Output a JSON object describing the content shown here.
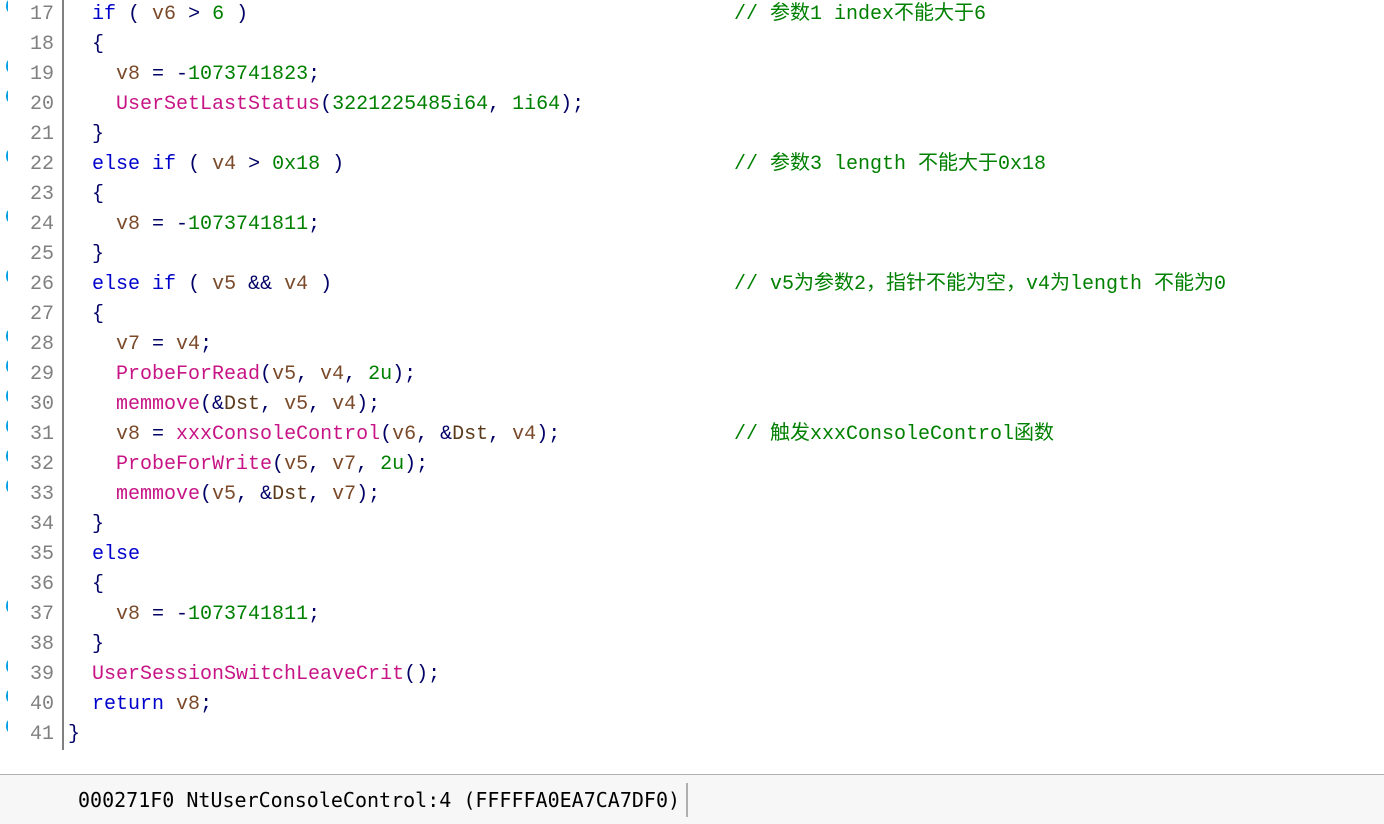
{
  "lines": [
    {
      "num": 17,
      "bp": true,
      "tokens": [
        [
          "  ",
          "p"
        ],
        [
          "if",
          "kw"
        ],
        [
          " ( ",
          "p"
        ],
        [
          "v6",
          "var"
        ],
        [
          " > ",
          "op"
        ],
        [
          "6",
          "num"
        ],
        [
          " )",
          "p"
        ]
      ],
      "comment": "// 参数1 index不能大于6",
      "commentCol": 740
    },
    {
      "num": 18,
      "bp": false,
      "tokens": [
        [
          "  {",
          "p"
        ]
      ]
    },
    {
      "num": 19,
      "bp": true,
      "tokens": [
        [
          "    ",
          "p"
        ],
        [
          "v8",
          "var"
        ],
        [
          " = -",
          "op"
        ],
        [
          "1073741823",
          "num"
        ],
        [
          ";",
          "p"
        ]
      ]
    },
    {
      "num": 20,
      "bp": true,
      "tokens": [
        [
          "    ",
          "p"
        ],
        [
          "UserSetLastStatus",
          "call"
        ],
        [
          "(",
          "p"
        ],
        [
          "3221225485i64",
          "num"
        ],
        [
          ", ",
          "p"
        ],
        [
          "1i64",
          "num"
        ],
        [
          ");",
          "p"
        ]
      ]
    },
    {
      "num": 21,
      "bp": false,
      "tokens": [
        [
          "  }",
          "p"
        ]
      ]
    },
    {
      "num": 22,
      "bp": true,
      "tokens": [
        [
          "  ",
          "p"
        ],
        [
          "else",
          "kw"
        ],
        [
          " ",
          "p"
        ],
        [
          "if",
          "kw"
        ],
        [
          " ( ",
          "p"
        ],
        [
          "v4",
          "var"
        ],
        [
          " > ",
          "op"
        ],
        [
          "0x18",
          "num"
        ],
        [
          " )",
          "p"
        ]
      ],
      "comment": "// 参数3 length 不能大于0x18",
      "commentCol": 740
    },
    {
      "num": 23,
      "bp": false,
      "tokens": [
        [
          "  {",
          "p"
        ]
      ]
    },
    {
      "num": 24,
      "bp": true,
      "tokens": [
        [
          "    ",
          "p"
        ],
        [
          "v8",
          "var"
        ],
        [
          " = -",
          "op"
        ],
        [
          "1073741811",
          "num"
        ],
        [
          ";",
          "p"
        ]
      ]
    },
    {
      "num": 25,
      "bp": false,
      "tokens": [
        [
          "  }",
          "p"
        ]
      ]
    },
    {
      "num": 26,
      "bp": true,
      "tokens": [
        [
          "  ",
          "p"
        ],
        [
          "else",
          "kw"
        ],
        [
          " ",
          "p"
        ],
        [
          "if",
          "kw"
        ],
        [
          " ( ",
          "p"
        ],
        [
          "v5",
          "var"
        ],
        [
          " ",
          "p"
        ],
        [
          "&&",
          "op"
        ],
        [
          " ",
          "p"
        ],
        [
          "v4",
          "var"
        ],
        [
          " )",
          "p"
        ]
      ],
      "comment": "// v5为参数2，指针不能为空，v4为length 不能为0",
      "commentCol": 740
    },
    {
      "num": 27,
      "bp": false,
      "tokens": [
        [
          "  {",
          "p"
        ]
      ]
    },
    {
      "num": 28,
      "bp": true,
      "tokens": [
        [
          "    ",
          "p"
        ],
        [
          "v7",
          "var"
        ],
        [
          " = ",
          "op"
        ],
        [
          "v4",
          "var"
        ],
        [
          ";",
          "p"
        ]
      ]
    },
    {
      "num": 29,
      "bp": true,
      "tokens": [
        [
          "    ",
          "p"
        ],
        [
          "ProbeForRead",
          "call"
        ],
        [
          "(",
          "p"
        ],
        [
          "v5",
          "var"
        ],
        [
          ", ",
          "p"
        ],
        [
          "v4",
          "var"
        ],
        [
          ", ",
          "p"
        ],
        [
          "2u",
          "num"
        ],
        [
          ");",
          "p"
        ]
      ]
    },
    {
      "num": 30,
      "bp": true,
      "tokens": [
        [
          "    ",
          "p"
        ],
        [
          "memmove",
          "call"
        ],
        [
          "(&",
          "p"
        ],
        [
          "Dst",
          "sym"
        ],
        [
          ", ",
          "p"
        ],
        [
          "v5",
          "var"
        ],
        [
          ", ",
          "p"
        ],
        [
          "v4",
          "var"
        ],
        [
          ");",
          "p"
        ]
      ]
    },
    {
      "num": 31,
      "bp": true,
      "tokens": [
        [
          "    ",
          "p"
        ],
        [
          "v8",
          "var"
        ],
        [
          " = ",
          "op"
        ],
        [
          "xxxConsoleControl",
          "call"
        ],
        [
          "(",
          "p"
        ],
        [
          "v6",
          "var"
        ],
        [
          ", &",
          "p"
        ],
        [
          "Dst",
          "sym"
        ],
        [
          ", ",
          "p"
        ],
        [
          "v4",
          "var"
        ],
        [
          ");",
          "p"
        ]
      ],
      "comment": "// 触发xxxConsoleControl函数",
      "commentCol": 740
    },
    {
      "num": 32,
      "bp": true,
      "tokens": [
        [
          "    ",
          "p"
        ],
        [
          "ProbeForWrite",
          "call"
        ],
        [
          "(",
          "p"
        ],
        [
          "v5",
          "var"
        ],
        [
          ", ",
          "p"
        ],
        [
          "v7",
          "var"
        ],
        [
          ", ",
          "p"
        ],
        [
          "2u",
          "num"
        ],
        [
          ");",
          "p"
        ]
      ]
    },
    {
      "num": 33,
      "bp": true,
      "tokens": [
        [
          "    ",
          "p"
        ],
        [
          "memmove",
          "call"
        ],
        [
          "(",
          "p"
        ],
        [
          "v5",
          "var"
        ],
        [
          ", &",
          "p"
        ],
        [
          "Dst",
          "sym"
        ],
        [
          ", ",
          "p"
        ],
        [
          "v7",
          "var"
        ],
        [
          ");",
          "p"
        ]
      ]
    },
    {
      "num": 34,
      "bp": false,
      "tokens": [
        [
          "  }",
          "p"
        ]
      ]
    },
    {
      "num": 35,
      "bp": false,
      "tokens": [
        [
          "  ",
          "p"
        ],
        [
          "else",
          "kw"
        ]
      ]
    },
    {
      "num": 36,
      "bp": false,
      "tokens": [
        [
          "  {",
          "p"
        ]
      ]
    },
    {
      "num": 37,
      "bp": true,
      "tokens": [
        [
          "    ",
          "p"
        ],
        [
          "v8",
          "var"
        ],
        [
          " = -",
          "op"
        ],
        [
          "1073741811",
          "num"
        ],
        [
          ";",
          "p"
        ]
      ]
    },
    {
      "num": 38,
      "bp": false,
      "tokens": [
        [
          "  }",
          "p"
        ]
      ]
    },
    {
      "num": 39,
      "bp": true,
      "tokens": [
        [
          "  ",
          "p"
        ],
        [
          "UserSessionSwitchLeaveCrit",
          "call"
        ],
        [
          "();",
          "p"
        ]
      ]
    },
    {
      "num": 40,
      "bp": true,
      "tokens": [
        [
          "  ",
          "p"
        ],
        [
          "return",
          "kw"
        ],
        [
          " ",
          "p"
        ],
        [
          "v8",
          "var"
        ],
        [
          ";",
          "p"
        ]
      ]
    },
    {
      "num": 41,
      "bp": true,
      "tokens": [
        [
          "}",
          "p"
        ]
      ]
    }
  ],
  "status": {
    "text": "000271F0 NtUserConsoleControl:4 (FFFFFA0EA7CA7DF0)"
  },
  "classmap": {
    "kw": "tok-kw",
    "var": "tok-var",
    "num": "tok-num",
    "call": "tok-call",
    "op": "tok-op",
    "p": "tok-punct",
    "cmt": "tok-cmt",
    "sym": "tok-sym"
  }
}
